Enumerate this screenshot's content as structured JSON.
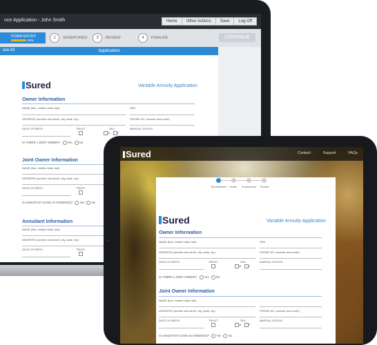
{
  "laptop": {
    "window_title": "nce Application - John Smith",
    "top_buttons": [
      "Home",
      "Other Actions",
      "Save",
      "Log Off"
    ],
    "steps": {
      "active_label": "FORM ENTRY",
      "active_percent": "99%",
      "s2": "2",
      "s2_label": "SIGNATURES",
      "s3": "3",
      "s3_label": "REVIEW",
      "s4": "4",
      "s4_label": "FINALIZE"
    },
    "continue_label": "CONTINUE",
    "back_label": "iew All",
    "app_label": "Application",
    "logo": "Sured",
    "form_title": "Variable Annuity Application",
    "owner": {
      "heading": "Owner Information",
      "name": "NAME (first, middle initial, last)",
      "ssn": "SSN",
      "address": "ADDRESS (number and street, city, state, zip)",
      "phone": "PHONE NO. (include area code)",
      "dob": "DATE OF BIRTH",
      "trust": "TRUST",
      "sex": "SEX",
      "m": "M",
      "f": "F",
      "marital": "MARITAL STATUS",
      "joint_q": "IS THERE A JOINT OWNER?",
      "yes": "Yes",
      "no": "No"
    },
    "joint": {
      "heading": "Joint Owner Information",
      "name": "NAME (first, middle initial, last)",
      "address": "ADDRESS (number and street, city, state, zip)",
      "dob": "DATE OF BIRTH",
      "trust": "TRUST",
      "annuitant_q": "IS ANNUITANT SAME AS OWNER(S)?",
      "yes": "Yes",
      "no": "No"
    },
    "annuitant": {
      "heading": "Annuitant Information",
      "name": "NAME (first, middle initial, last)",
      "address": "ADDRESS (number and street, city, state, zip)",
      "dob": "DATE OF BIRTH",
      "trust": "TRUST"
    }
  },
  "tablet": {
    "logo": "Sured",
    "nav_links": [
      "Contact",
      "Support",
      "FAQs"
    ],
    "progress_labels": [
      "Beneficiaries",
      "Health",
      "Employment",
      "Review"
    ],
    "form_logo": "Sured",
    "form_title": "Variable Annuity Application",
    "owner": {
      "heading": "Owner Information",
      "name": "NAME (first, middle initial, last)",
      "ssn": "SSN",
      "address": "ADDRESS (number and street, city, state, zip)",
      "phone": "PHONE NO. (include area code)",
      "dob": "DATE OF BIRTH",
      "trust": "TRUST",
      "sex": "SEX",
      "m": "M",
      "f": "F",
      "marital": "MARITAL STATUS",
      "joint_q": "IS THERE A JOINT OWNER?",
      "yes": "Yes",
      "no": "No"
    },
    "joint": {
      "heading": "Joint Owner Information",
      "name": "NAME (first, middle initial, last)",
      "address": "ADDRESS (number and street, city, state, zip)",
      "phone": "PHONE NO. (include area code)",
      "dob": "DATE OF BIRTH",
      "trust": "TRUST",
      "sex": "SEX",
      "m": "M",
      "f": "F",
      "marital": "MARITAL STATUS",
      "annuitant_q": "IS ANNUITANT SAME AS OWNER(S)?",
      "yes": "Yes",
      "no": "No"
    }
  },
  "colors": {
    "accent_blue": "#2a8bd8",
    "progress_yellow": "#f0b323",
    "section_blue": "#2f5ca5",
    "logo_navy": "#1c1f3f"
  }
}
